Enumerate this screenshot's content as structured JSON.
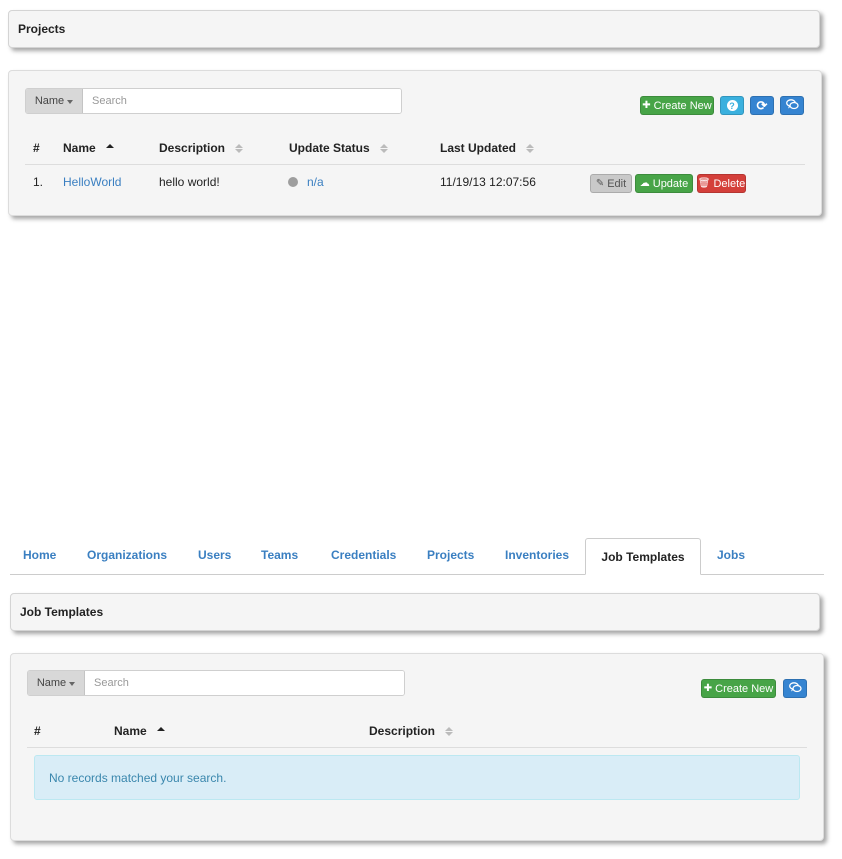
{
  "projects": {
    "title": "Projects",
    "search": {
      "field": "Name",
      "placeholder": "Search"
    },
    "buttons": {
      "create_new": "Create New",
      "help": "?",
      "refresh": "⟳",
      "stream": "💬"
    },
    "columns": [
      "#",
      "Name",
      "Description",
      "Update Status",
      "Last Updated"
    ],
    "rows": [
      {
        "index": "1.",
        "name": "HelloWorld",
        "description": "hello world!",
        "status": "n/a",
        "last_updated": "11/19/13 12:07:56",
        "actions": {
          "edit": "Edit",
          "update": "Update",
          "delete": "Delete"
        }
      }
    ]
  },
  "nav": {
    "tabs": [
      "Home",
      "Organizations",
      "Users",
      "Teams",
      "Credentials",
      "Projects",
      "Inventories",
      "Job Templates",
      "Jobs"
    ],
    "active": "Job Templates"
  },
  "job_templates": {
    "title": "Job Templates",
    "search": {
      "field": "Name",
      "placeholder": "Search"
    },
    "buttons": {
      "create_new": "Create New",
      "stream": "💬"
    },
    "columns": [
      "#",
      "Name",
      "Description"
    ],
    "empty_message": "No records matched your search."
  },
  "colors": {
    "success": "#47a447",
    "info": "#3ab0de",
    "primary": "#3584d1",
    "danger": "#d43f3a",
    "link": "#3a7fc1",
    "alert_bg": "#d9edf7"
  }
}
